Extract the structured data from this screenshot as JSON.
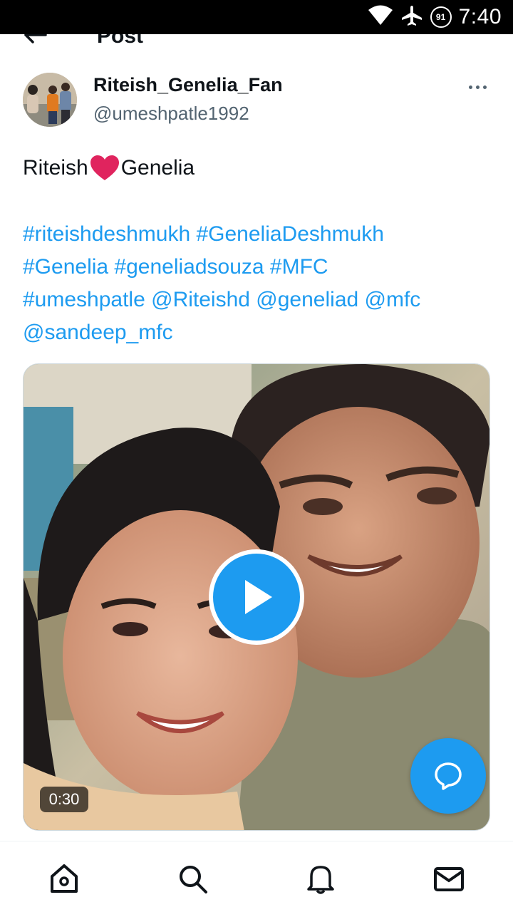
{
  "status_bar": {
    "time": "7:40",
    "battery_level": "91",
    "icons": [
      "wifi-icon",
      "airplane-icon",
      "battery-icon"
    ]
  },
  "header": {
    "title": "Post",
    "back_icon": "back-arrow-icon"
  },
  "author": {
    "display_name": "Riteish_Genelia_Fan",
    "handle": "@umeshpatle1992"
  },
  "tweet": {
    "text_before_emoji": "Riteish",
    "emoji": "heart-icon",
    "text_after_emoji": "Genelia",
    "tag_lines": [
      "#riteishdeshmukh #GeneliaDeshmukh",
      "#Genelia #geneliadsouza #MFC",
      "#umeshpatle @Riteishd @geneliad @mfc",
      "@sandeep_mfc"
    ]
  },
  "media": {
    "duration": "0:30",
    "play_icon": "play-icon"
  },
  "fab_icon": "reply-icon",
  "bottom_nav": [
    "home-icon",
    "search-icon",
    "notifications-icon",
    "messages-icon"
  ],
  "colors": {
    "accent": "#1d9bf0",
    "text": "#0f1419",
    "secondary_text": "#536471",
    "heart": "#e0245e"
  }
}
